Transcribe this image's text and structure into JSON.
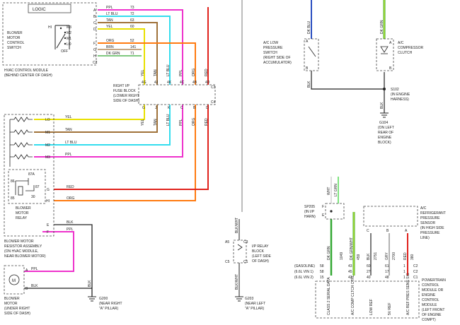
{
  "hvac": {
    "logic": "LOGIC",
    "switch_label": [
      "BLOWER",
      "MOTOR",
      "CONTROL",
      "SWITCH"
    ],
    "positions": [
      "HI",
      "M3",
      "M2",
      "M1",
      "LO",
      "OFF"
    ],
    "module_name": "HVAC CONTROL MODULE",
    "module_loc": "(BEHIND CENTER OF DASH)",
    "connector": "C2",
    "pins": [
      {
        "pin": "A",
        "color": "PPL",
        "circuit": "73"
      },
      {
        "pin": "B",
        "color": "LT BLU",
        "circuit": "72"
      },
      {
        "pin": "C",
        "color": "TAN",
        "circuit": "63"
      },
      {
        "pin": "D",
        "color": "YEL",
        "circuit": "60"
      },
      {
        "pin": "F",
        "color": "ORG",
        "circuit": "52"
      },
      {
        "pin": "G",
        "color": "BRN",
        "circuit": "141"
      },
      {
        "pin": "H",
        "color": "DK GRN",
        "circuit": "71"
      }
    ]
  },
  "fuse_block": {
    "label": [
      "RIGHT I/P",
      "FUSE BLOCK",
      "(LOWER RIGHT",
      "SIDE OF DASH)"
    ],
    "columns": [
      {
        "top": "4G",
        "bottom": "G",
        "color": "YEL"
      },
      {
        "top": "4J",
        "bottom": "J",
        "color": "TAN"
      },
      {
        "top": "4K",
        "bottom": "K",
        "color": "LT BLU"
      },
      {
        "top": "4C",
        "bottom": "C",
        "color": "PPL"
      },
      {
        "top": "4B",
        "bottom": "B",
        "color": "ORG"
      },
      {
        "top": "4D",
        "bottom": "D",
        "color": "RED"
      }
    ],
    "top_conn": "C3",
    "bottom_conn": "C4",
    "extra_labels": [
      "ORG",
      "RED"
    ]
  },
  "resistor": {
    "rows": [
      {
        "tag": "LO",
        "color": "YEL"
      },
      {
        "tag": "M1",
        "color": "TAN"
      },
      {
        "tag": "M2",
        "color": "LT BLU"
      },
      {
        "tag": "M3",
        "color": "PPL"
      }
    ],
    "relay_pins": [
      {
        "pin": "G",
        "color": "RED"
      },
      {
        "pin": "HI",
        "color": "ORG"
      },
      {
        "pin": "E",
        "color": "BLK"
      },
      {
        "pin": "F",
        "color": "PPL"
      }
    ],
    "relay_nums": [
      "87A",
      "87",
      "86",
      "30",
      "85"
    ],
    "relay_label": [
      "BLOWER",
      "MOTOR",
      "RELAY"
    ],
    "assembly_label": [
      "BLOWER MOTOR",
      "RESISTOR ASSEMBLY",
      "(ON HVAC MODULE,",
      "NEAR BLOWER MOTOR)"
    ]
  },
  "motor": {
    "pin_a": "A",
    "pin_b": "B",
    "color_a": "PPL",
    "color_b": "BLK",
    "label": [
      "BLOWER",
      "MOTOR",
      "(UNDER RIGHT",
      "SIDE OF DASH)"
    ]
  },
  "grounds": {
    "g200": "G200",
    "g200_loc": [
      "(NEAR RIGHT",
      "\"A\" PILLAR)"
    ],
    "g200_wire": "BLK",
    "g203": "G203",
    "g203_loc": [
      "(NEAR LEFT",
      "\"A\" PILLAR)"
    ],
    "ip_relay": [
      "I/P RELAY",
      "BLOCK",
      "(LEFT SIDE",
      "OF DASH)"
    ],
    "ip_relay_pins": [
      "A5",
      "C3",
      "C5",
      "C1"
    ],
    "ip_relay_wires": [
      "BLK/WHT",
      "BLK/WHT"
    ]
  },
  "ac_switch": {
    "label": [
      "A/C LOW",
      "PRESSURE",
      "SWITCH",
      "(RIGHT SIDE OF",
      "ACCUMULATOR)"
    ],
    "pins": [
      "A",
      "B"
    ],
    "wire_top": "DK BLU",
    "wire_bottom": "BLK"
  },
  "ac_clutch": {
    "label": [
      "A/C",
      "COMPRESSOR",
      "CLUTCH"
    ],
    "pins": [
      "A",
      "B"
    ],
    "wire_top": "DK GRN"
  },
  "splice": {
    "s102": "S102",
    "s102_loc": [
      "(IN ENGINE",
      "HARNESS)"
    ],
    "g104": "G104",
    "g104_loc": [
      "(ON LEFT",
      "REAR OF",
      "ENGINE",
      "BLOCK)"
    ],
    "wire": "BLK",
    "sp205": "SP205",
    "sp205_loc": [
      "(IN I/P",
      "HARN)"
    ],
    "sp205_pins": [
      "F",
      "E"
    ],
    "sp_wires": [
      "WHT",
      "LT GRN"
    ]
  },
  "sensor": {
    "label": [
      "A/C",
      "REFRIGERANT",
      "PRESSURE",
      "SENSOR",
      "(IN HIGH SIDE",
      "PRESSURE",
      "LINE)"
    ],
    "pins": [
      "C",
      "B",
      "A"
    ]
  },
  "pcm": {
    "label": [
      "POWERTRAIN",
      "CONTROL",
      "MODULE OR",
      "ENGINE",
      "CONTROL",
      "MODULE",
      "(LEFT FRONT",
      "OF ENGINE",
      "COMPT)"
    ],
    "rows": [
      {
        "label": "(GASOLINE)",
        "vals": [
          "58",
          "43",
          "60",
          "61",
          "1",
          "C2"
        ]
      },
      {
        "label": "(6.6L VIN 1)",
        "vals": [
          "58",
          "45",
          "27",
          "17",
          "1",
          "C2"
        ]
      },
      {
        "label": "(6.6L VIN 2)",
        "vals": [
          "15",
          "42",
          "40",
          "48",
          "1",
          "C1"
        ]
      }
    ],
    "wires": [
      {
        "color": "DK GRN",
        "circuit": "1049"
      },
      {
        "color": "DK GRN/WHT",
        "circuit": "459"
      },
      {
        "color": "BLK",
        "circuit": "2751"
      },
      {
        "color": "GRY",
        "circuit": "2700"
      },
      {
        "color": "RED",
        "circuit": "380"
      }
    ],
    "functions": [
      "CLASS 2 SERIAL DATA",
      "A/C COMP CLTCH CTRL",
      "LOW REF",
      "5V REF",
      "A/C REF PRES SENS SIG"
    ]
  },
  "wire_colors": {
    "ppl": "#ee33cc",
    "ltblu": "#33ddee",
    "tan": "#a0723a",
    "yel": "#e8e000",
    "org": "#ff7a10",
    "red": "#e0221c",
    "blk": "#222222",
    "dkgrn": "#33a833",
    "dkblu": "#2a4fc0",
    "gry": "#999999",
    "wht": "#dddddd",
    "dkgrnwht": "#d8ee30"
  }
}
